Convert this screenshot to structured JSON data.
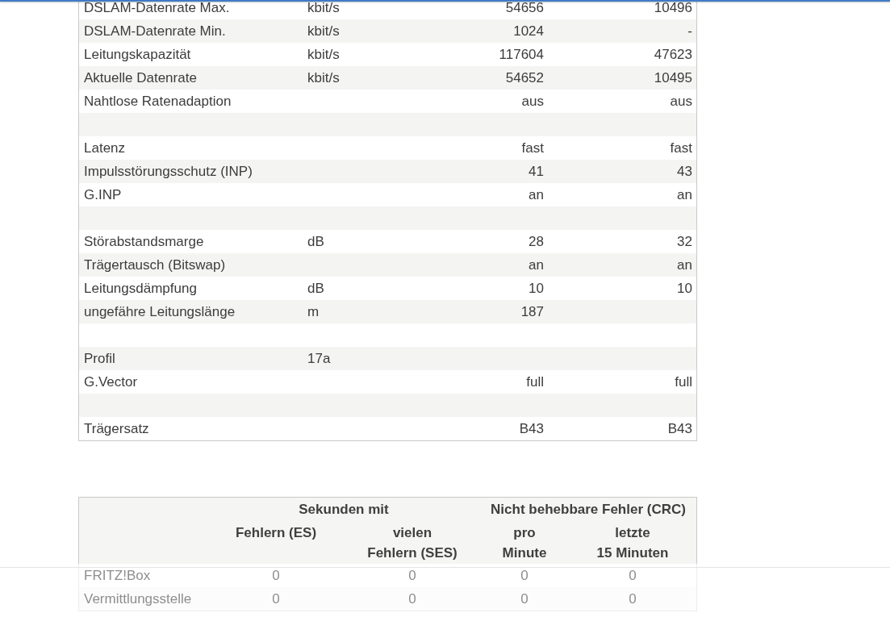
{
  "dsl_table": {
    "rows": [
      {
        "kind": "data",
        "column_1": "DSLAM-Datenrate Max.",
        "column_2": "kbit/s",
        "column_3": "54656",
        "column_4": "10496"
      },
      {
        "kind": "data",
        "column_1": "DSLAM-Datenrate Min.",
        "column_2": "kbit/s",
        "column_3": "1024",
        "column_4": "-"
      },
      {
        "kind": "data",
        "column_1": "Leitungskapazität",
        "column_2": "kbit/s",
        "column_3": "117604",
        "column_4": "47623"
      },
      {
        "kind": "data",
        "column_1": "Aktuelle Datenrate",
        "column_2": "kbit/s",
        "column_3": "54652",
        "column_4": "10495"
      },
      {
        "kind": "data",
        "column_1": "Nahtlose Ratenadaption",
        "column_3": "aus",
        "column_4": "aus"
      },
      {
        "kind": "spacer"
      },
      {
        "kind": "data",
        "column_1": "Latenz",
        "column_3": "fast",
        "column_4": "fast"
      },
      {
        "kind": "data",
        "column_1": "Impulsstörungsschutz (INP)",
        "column_3": "41",
        "column_4": "43"
      },
      {
        "kind": "data",
        "column_1": "G.INP",
        "column_3": "an",
        "column_4": "an"
      },
      {
        "kind": "spacer"
      },
      {
        "kind": "data",
        "column_1": "Störabstandsmarge",
        "column_2": "dB",
        "column_3": "28",
        "column_4": "32"
      },
      {
        "kind": "data",
        "column_1": "Trägertausch (Bitswap)",
        "column_3": "an",
        "column_4": "an"
      },
      {
        "kind": "data",
        "column_1": "Leitungsdämpfung",
        "column_2": "dB",
        "column_3": "10",
        "column_4": "10"
      },
      {
        "kind": "data",
        "column_1": "ungefähre Leitungslänge",
        "column_2": "m",
        "column_3": "187"
      },
      {
        "kind": "spacer"
      },
      {
        "kind": "data",
        "column_1": "Profil",
        "column_2": "17a"
      },
      {
        "kind": "data",
        "column_1": "G.Vector",
        "column_3": "full",
        "column_4": "full"
      },
      {
        "kind": "spacer"
      },
      {
        "kind": "data",
        "column_1": "Trägersatz",
        "column_3": "B43",
        "column_4": "B43"
      }
    ]
  },
  "error_table": {
    "header_groups": [
      "Sekunden mit",
      "Nicht behebbare Fehler (CRC)"
    ],
    "columns": [
      "Fehlern (ES)",
      "vielen\nFehlern (SES)",
      "pro\nMinute",
      "letzte\n15 Minuten"
    ],
    "rows": [
      {
        "label": "FRITZ!Box",
        "values": [
          "0",
          "0",
          "0",
          "0"
        ]
      },
      {
        "label": "Vermittlungsstelle",
        "values": [
          "0",
          "0",
          "0",
          "0"
        ]
      }
    ]
  }
}
